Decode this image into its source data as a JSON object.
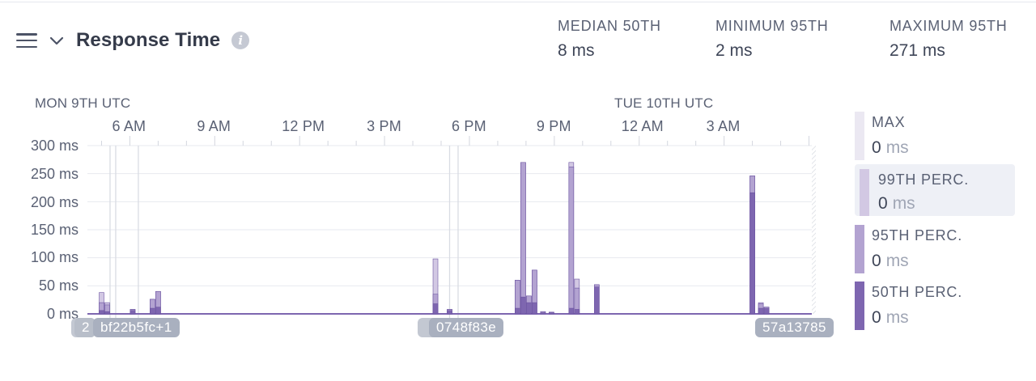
{
  "panel": {
    "title": "Response Time",
    "stats": [
      {
        "label": "MEDIAN 50TH",
        "value": "8 ms"
      },
      {
        "label": "MINIMUM 95TH",
        "value": "2 ms"
      },
      {
        "label": "MAXIMUM 95TH",
        "value": "271 ms"
      }
    ]
  },
  "chart_data": {
    "type": "bar",
    "stacked_overlay": true,
    "day_labels": [
      "MON 9TH UTC",
      "TUE 10TH UTC"
    ],
    "x_tick_labels": [
      "6 AM",
      "9 AM",
      "12 PM",
      "3 PM",
      "6 PM",
      "9 PM",
      "12 AM",
      "3 AM"
    ],
    "y_tick_labels": [
      "300 ms",
      "250 ms",
      "200 ms",
      "150 ms",
      "100 ms",
      "50 ms",
      "0 ms"
    ],
    "ylim": [
      0,
      300
    ],
    "x_hours": [
      4.5,
      30.1
    ],
    "series_colors": {
      "max": "#ebe8f2",
      "p99": "#d2c8e3",
      "p95": "#b3a3d1",
      "p50": "#7e66b0"
    },
    "bars": [
      {
        "t": 5.0,
        "p99": 38,
        "p95": 20,
        "p50": 6
      },
      {
        "t": 5.2,
        "p99": 20,
        "p95": 16,
        "p50": 4
      },
      {
        "t": 6.1,
        "p99": 8,
        "p95": 8,
        "p50": 6
      },
      {
        "t": 6.8,
        "p99": 26,
        "p95": 26,
        "p50": 10
      },
      {
        "t": 7.0,
        "p99": 40,
        "p95": 40,
        "p50": 12
      },
      {
        "t": 16.8,
        "p99": 98,
        "p95": 35,
        "p50": 18
      },
      {
        "t": 17.3,
        "p99": 8,
        "p95": 8,
        "p50": 6
      },
      {
        "t": 19.7,
        "p99": 60,
        "p95": 60,
        "p50": 10
      },
      {
        "t": 19.9,
        "p99": 270,
        "p95": 270,
        "p50": 30
      },
      {
        "t": 20.1,
        "p99": 32,
        "p95": 32,
        "p50": 20
      },
      {
        "t": 20.3,
        "p99": 78,
        "p95": 78,
        "p50": 20
      },
      {
        "t": 20.6,
        "p99": 4,
        "p95": 4,
        "p50": 2
      },
      {
        "t": 20.9,
        "p99": 3,
        "p95": 3,
        "p50": 2
      },
      {
        "t": 21.6,
        "p99": 270,
        "p95": 262,
        "p50": 10
      },
      {
        "t": 21.8,
        "p99": 62,
        "p95": 46,
        "p50": 8
      },
      {
        "t": 22.5,
        "p99": 52,
        "p95": 52,
        "p50": 48
      },
      {
        "t": 28.0,
        "p99": 246,
        "p95": 246,
        "p50": 216
      },
      {
        "t": 28.3,
        "p99": 20,
        "p95": 18,
        "p50": 10
      },
      {
        "t": 28.5,
        "p99": 12,
        "p95": 12,
        "p50": 10
      }
    ],
    "deploy_marker_hours": [
      5.3,
      5.5,
      6.3,
      17.3,
      17.6
    ]
  },
  "commits": [
    {
      "label": "2",
      "stub": true
    },
    {
      "label": "bf22b5fc+1",
      "stub": false
    },
    {
      "label": "0748f83e",
      "stub": false
    },
    {
      "label": "57a13785",
      "stub": false
    }
  ],
  "legend": [
    {
      "name": "MAX",
      "value": "0",
      "unit": "ms",
      "color": "#ebe8f2",
      "active": false
    },
    {
      "name": "99TH PERC.",
      "value": "0",
      "unit": "ms",
      "color": "#d2c8e3",
      "active": true
    },
    {
      "name": "95TH PERC.",
      "value": "0",
      "unit": "ms",
      "color": "#b3a3d1",
      "active": false
    },
    {
      "name": "50TH PERC.",
      "value": "0",
      "unit": "ms",
      "color": "#7e66b0",
      "active": false
    }
  ]
}
